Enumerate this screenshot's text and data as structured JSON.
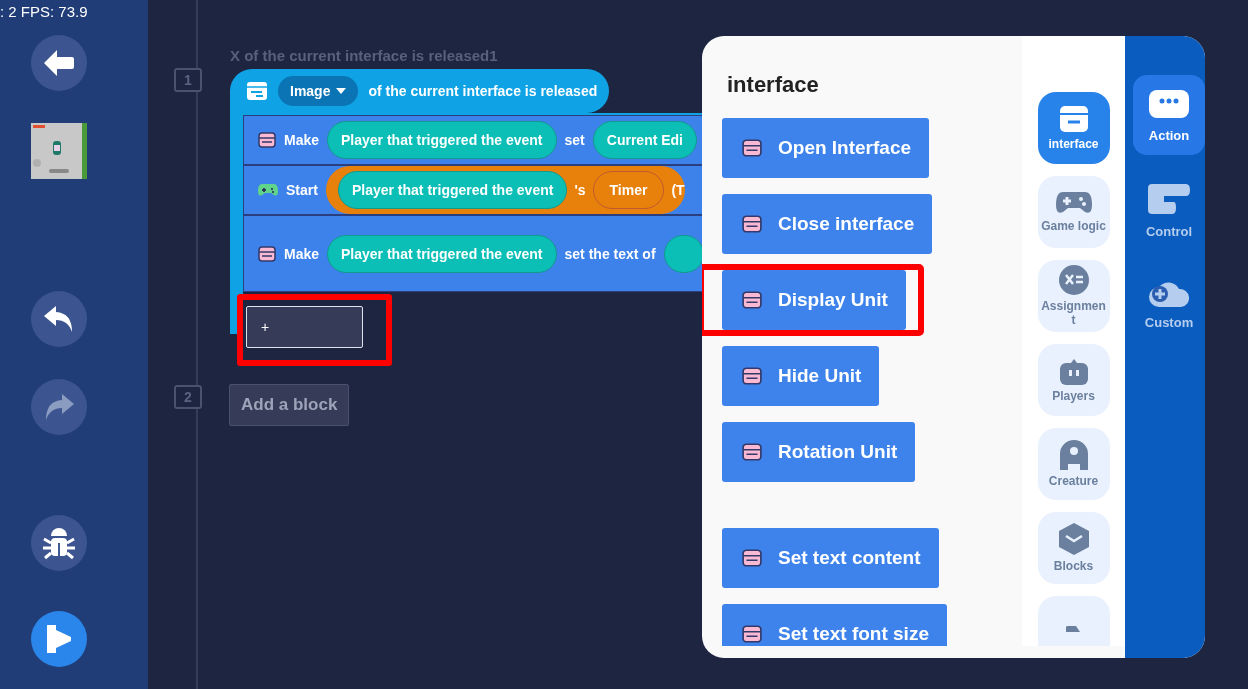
{
  "fps_label": ": 2 FPS: 73.9",
  "toolbar": [
    {
      "kind": "back",
      "disabled": false
    },
    {
      "kind": "thumbnail",
      "disabled": false
    },
    {
      "kind": "undo",
      "disabled": false
    },
    {
      "kind": "redo",
      "disabled": true
    },
    {
      "kind": "debug",
      "disabled": false
    },
    {
      "kind": "run",
      "disabled": false
    }
  ],
  "script": {
    "event_number": "1",
    "event_title": "X of the current interface is released1",
    "trigger": {
      "dropdown": "Image",
      "text": "of the current interface is released"
    },
    "statements": [
      {
        "kind": "interface",
        "tall": false,
        "parts": [
          {
            "kind": "text",
            "text": "Make"
          },
          {
            "kind": "pill",
            "text": "Player that triggered the event"
          },
          {
            "kind": "text",
            "text": "set"
          },
          {
            "kind": "pill",
            "text": "Current Edi"
          }
        ]
      },
      {
        "kind": "gamepad",
        "tall": false,
        "parts": [
          {
            "kind": "text",
            "text": "Start"
          },
          {
            "kind": "capsule",
            "parts": [
              {
                "kind": "pill",
                "text": "Player that triggered the event"
              },
              {
                "kind": "text",
                "text": "'s"
              },
              {
                "kind": "orange",
                "text": "Timer"
              },
              {
                "kind": "text",
                "text": "(T"
              }
            ]
          }
        ]
      },
      {
        "kind": "interface",
        "tall": true,
        "parts": [
          {
            "kind": "text",
            "text": "Make"
          },
          {
            "kind": "pill",
            "text": "Player that triggered the event"
          },
          {
            "kind": "text",
            "text": "set the text of"
          },
          {
            "kind": "pill"
          }
        ]
      }
    ],
    "add_slot": {
      "label": "+",
      "highlighted": true
    },
    "next_number": "2",
    "add_block": "Add a block"
  },
  "panel": {
    "title": "interface",
    "groups": [
      {
        "blocks": [
          {
            "label": "Open Interface",
            "highlighted": false
          },
          {
            "label": "Close interface",
            "highlighted": false
          },
          {
            "label": "Display Unit",
            "highlighted": true
          },
          {
            "label": "Hide Unit",
            "highlighted": false
          },
          {
            "label": "Rotation Unit",
            "highlighted": false
          }
        ]
      },
      {
        "blocks": [
          {
            "label": "Set text content",
            "highlighted": false
          },
          {
            "label": "Set text font size",
            "highlighted": false
          }
        ]
      }
    ],
    "categories": [
      {
        "kind": "interface",
        "label": "interface",
        "selected": true
      },
      {
        "kind": "gamepad",
        "label": "Game logic",
        "selected": false
      },
      {
        "kind": "assign",
        "label": "Assignment",
        "selected": false
      },
      {
        "kind": "robot",
        "label": "Players",
        "selected": false
      },
      {
        "kind": "ghost",
        "label": "Creature",
        "selected": false
      },
      {
        "kind": "cube",
        "label": "Blocks",
        "selected": false
      },
      {
        "kind": "more",
        "selected": false
      }
    ],
    "tabs": [
      {
        "kind": "action",
        "label": "Action",
        "selected": true
      },
      {
        "kind": "control",
        "label": "Control",
        "selected": false
      },
      {
        "kind": "custom",
        "label": "Custom",
        "selected": false
      }
    ]
  }
}
